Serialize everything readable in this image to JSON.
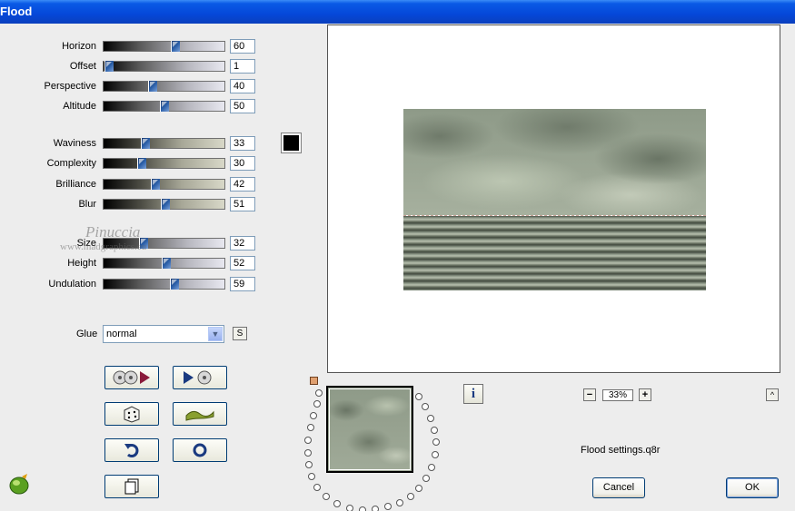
{
  "window": {
    "title": "Flood"
  },
  "sliders": [
    {
      "label": "Horizon",
      "value": "60",
      "fraction": 0.6,
      "track": "gray"
    },
    {
      "label": "Offset",
      "value": "1",
      "fraction": 0.01,
      "track": "gray"
    },
    {
      "label": "Perspective",
      "value": "40",
      "fraction": 0.4,
      "track": "gray"
    },
    {
      "label": "Altitude",
      "value": "50",
      "fraction": 0.5,
      "track": "gray"
    },
    {
      "label": "Waviness",
      "value": "33",
      "fraction": 0.33,
      "track": "green"
    },
    {
      "label": "Complexity",
      "value": "30",
      "fraction": 0.3,
      "track": "green"
    },
    {
      "label": "Brilliance",
      "value": "42",
      "fraction": 0.42,
      "track": "green"
    },
    {
      "label": "Blur",
      "value": "51",
      "fraction": 0.51,
      "track": "green"
    },
    {
      "label": "Size",
      "value": "32",
      "fraction": 0.32,
      "track": "gray"
    },
    {
      "label": "Height",
      "value": "52",
      "fraction": 0.52,
      "track": "gray"
    },
    {
      "label": "Undulation",
      "value": "59",
      "fraction": 0.59,
      "track": "gray"
    }
  ],
  "color_swatch": "#000000",
  "watermark": {
    "line1": "Pinuccia",
    "line2": "www.madgraphics.eu"
  },
  "glue": {
    "label": "Glue",
    "value": "normal",
    "s_button": "S"
  },
  "tool_buttons": [
    {
      "name": "randomize-preset-button",
      "icon": "disc-play-icon"
    },
    {
      "name": "next-preset-button",
      "icon": "play-disc-icon"
    },
    {
      "name": "random-dice-button",
      "icon": "dice-icon"
    },
    {
      "name": "wave-button",
      "icon": "wave-icon"
    },
    {
      "name": "undo-button",
      "icon": "undo-arrow-icon"
    },
    {
      "name": "reset-button",
      "icon": "ring-icon"
    },
    {
      "name": "copy-button",
      "icon": "page-icon"
    }
  ],
  "info_button": {
    "label": "i"
  },
  "zoom": {
    "minus": "−",
    "value": "33%",
    "plus": "+"
  },
  "caret_button": {
    "label": "^"
  },
  "settings_file": "Flood settings.q8r",
  "buttons": {
    "cancel": "Cancel",
    "ok": "OK"
  },
  "colors": {
    "titlebar": "#0548d9",
    "thumb": "#2b5fa8",
    "accent_marker": "#e0a070"
  }
}
